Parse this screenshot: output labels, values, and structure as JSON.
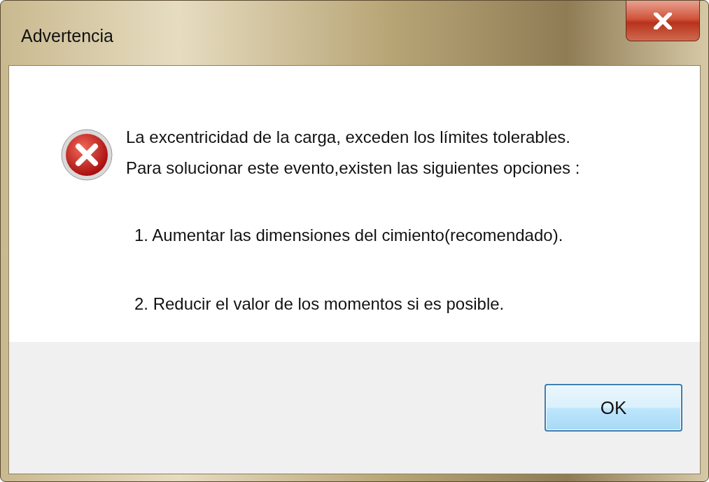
{
  "window": {
    "title": "Advertencia"
  },
  "message": {
    "lines": [
      "La excentricidad de la carga, exceden los límites tolerables.",
      "Para solucionar este evento,existen las siguientes opciones :"
    ],
    "options": [
      "1. Aumentar las dimensiones del cimiento(recomendado).",
      "2. Reducir el valor de los momentos si es posible."
    ]
  },
  "buttons": [
    "OK"
  ]
}
